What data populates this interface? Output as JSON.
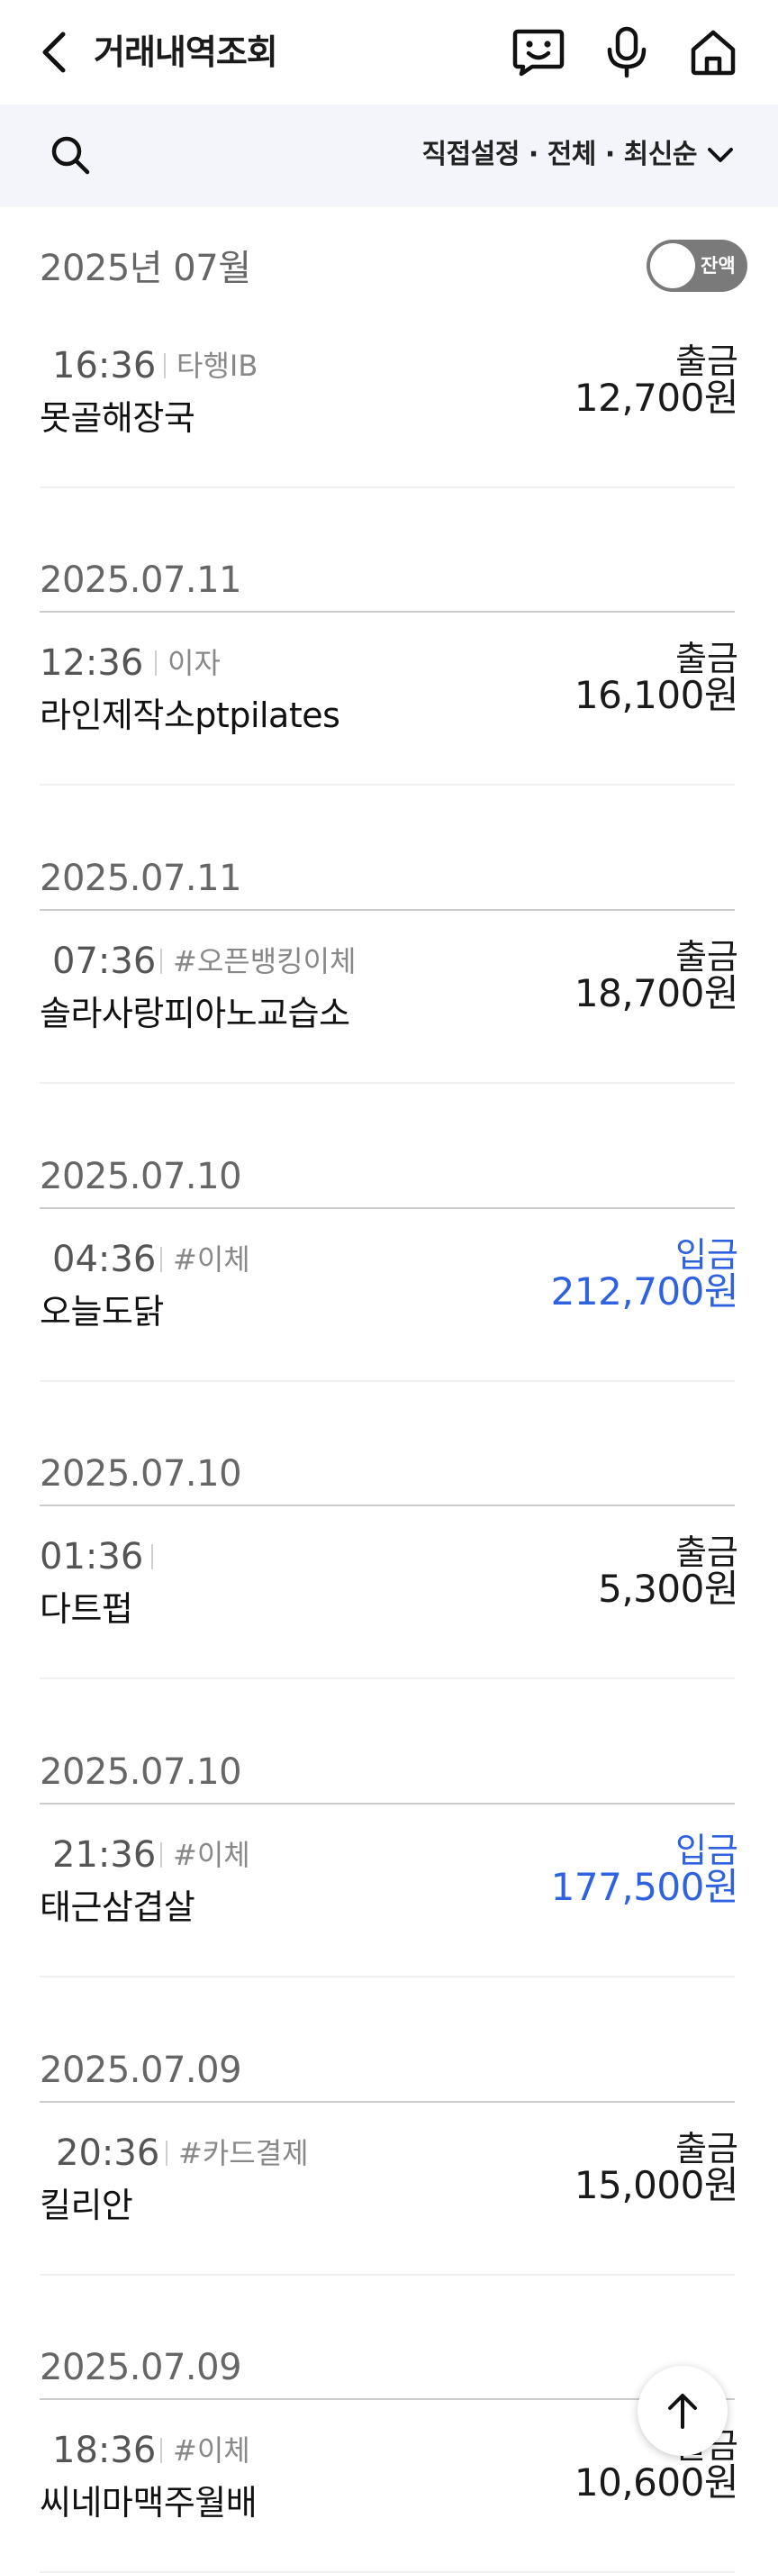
{
  "header": {
    "title": "거래내역조회",
    "icons": [
      "back-arrow-icon",
      "chatbot-icon",
      "microphone-icon",
      "home-icon"
    ]
  },
  "filter": {
    "summary": "직접설정 · 전체 · 최신순",
    "icons": [
      "search-icon",
      "chevron-down-icon"
    ]
  },
  "month_header": {
    "label": "2025년 07월",
    "balance_toggle_label": "잔액",
    "balance_toggle_on": false
  },
  "colors": {
    "deposit": "#2f62e0",
    "withdrawal": "#1a1a1a",
    "toggle": "#7a7a7a"
  },
  "groups": [
    {
      "date": "",
      "transactions": [
        {
          "time": "16:36",
          "tag": "타행IB",
          "merchant": "못골해장국",
          "type": "출금",
          "amount": "12,700원"
        }
      ]
    },
    {
      "date": "2025.07.11",
      "transactions": [
        {
          "time": "12:36",
          "tag": "이자",
          "merchant": "라인제작소ptpilates",
          "type": "출금",
          "amount": "16,100원"
        }
      ]
    },
    {
      "date": "2025.07.11",
      "transactions": [
        {
          "time": "07:36",
          "tag": "#오픈뱅킹이체",
          "merchant": "솔라사랑피아노교습소",
          "type": "출금",
          "amount": "18,700원"
        }
      ]
    },
    {
      "date": "2025.07.10",
      "transactions": [
        {
          "time": "04:36",
          "tag": "#이체",
          "merchant": "오늘도닭",
          "type": "입금",
          "amount": "212,700원"
        }
      ]
    },
    {
      "date": "2025.07.10",
      "transactions": [
        {
          "time": "01:36",
          "tag": "",
          "merchant": "다트펍",
          "type": "출금",
          "amount": "5,300원"
        }
      ]
    },
    {
      "date": "2025.07.10",
      "transactions": [
        {
          "time": "21:36",
          "tag": "#이체",
          "merchant": "태근삼겹살",
          "type": "입금",
          "amount": "177,500원"
        }
      ]
    },
    {
      "date": "2025.07.09",
      "transactions": [
        {
          "time": "20:36",
          "tag": "#카드결제",
          "merchant": "킬리안",
          "type": "출금",
          "amount": "15,000원"
        }
      ]
    },
    {
      "date": "2025.07.09",
      "transactions": [
        {
          "time": "18:36",
          "tag": "#이체",
          "merchant": "씨네마맥주월배",
          "type": "출금",
          "amount": "10,600원"
        }
      ]
    }
  ],
  "scroll_top_icon": "arrow-up-icon"
}
